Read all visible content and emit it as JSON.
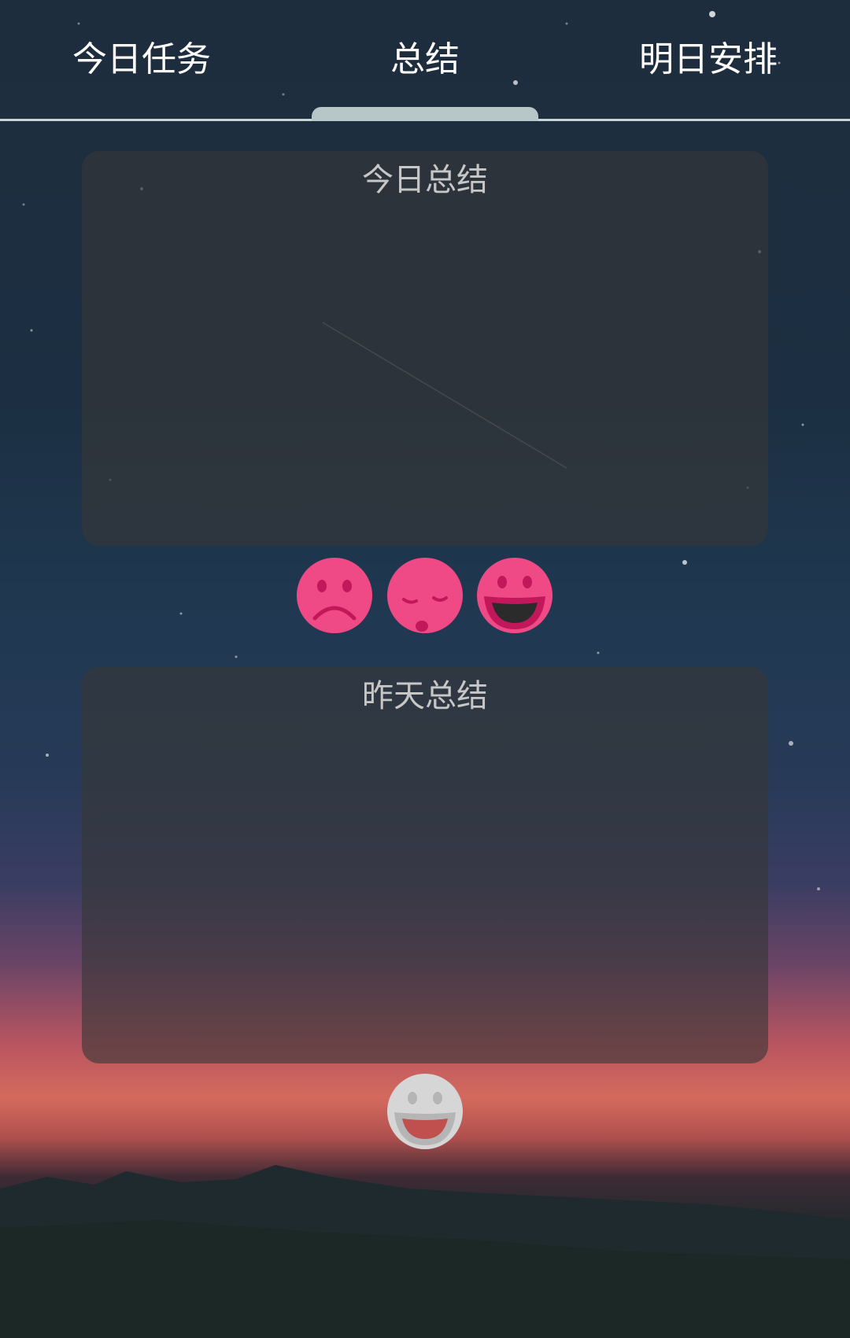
{
  "tabs": [
    {
      "label": "今日任务"
    },
    {
      "label": "总结"
    },
    {
      "label": "明日安排"
    }
  ],
  "active_tab": "总结",
  "today_card": {
    "title": "今日总结",
    "value": ""
  },
  "mood_options": [
    {
      "icon": "sad-face-icon"
    },
    {
      "icon": "sleepy-face-icon"
    },
    {
      "icon": "grinning-face-icon"
    }
  ],
  "yesterday_card": {
    "title": "昨天总结",
    "value": ""
  },
  "yesterday_mood": {
    "icon": "grinning-face-icon"
  },
  "colors": {
    "mood_pink": "#f04a86",
    "mood_feature": "#c2185b",
    "inactive_mood": "#d6d6d6",
    "indicator": "#b7c6c6"
  }
}
